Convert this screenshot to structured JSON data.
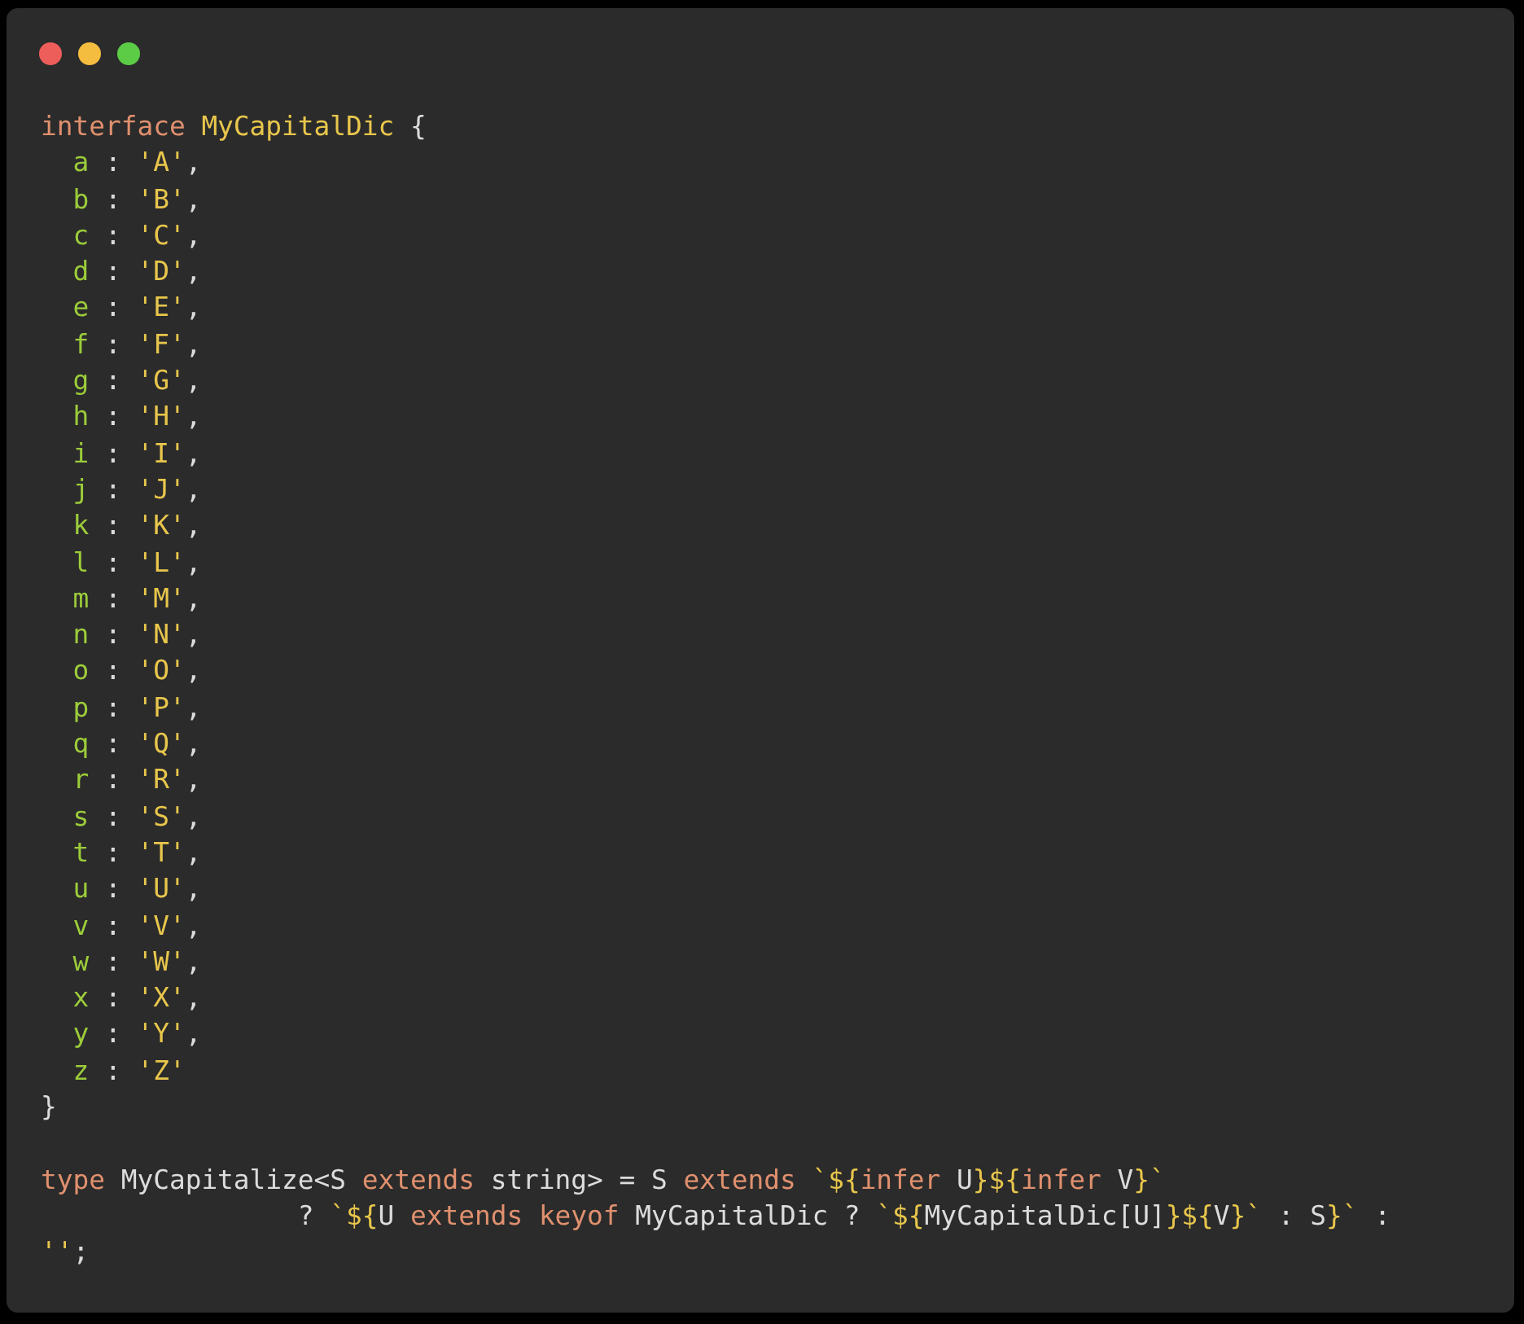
{
  "window": {
    "controls": [
      {
        "kind": "close"
      },
      {
        "kind": "minimize"
      },
      {
        "kind": "zoom"
      }
    ]
  },
  "code": {
    "lines": [
      {
        "kind": "code",
        "tokens": [
          {
            "kind": "kw",
            "text": "interface "
          },
          {
            "kind": "type",
            "text": "MyCapitalDic"
          },
          {
            "kind": "plain",
            "text": " {"
          }
        ]
      },
      {
        "kind": "code",
        "tokens": [
          {
            "kind": "prop",
            "text": "  a"
          },
          {
            "kind": "plain",
            "text": " : "
          },
          {
            "kind": "str",
            "text": "'A'"
          },
          {
            "kind": "plain",
            "text": ","
          }
        ]
      },
      {
        "kind": "code",
        "tokens": [
          {
            "kind": "prop",
            "text": "  b"
          },
          {
            "kind": "plain",
            "text": " : "
          },
          {
            "kind": "str",
            "text": "'B'"
          },
          {
            "kind": "plain",
            "text": ","
          }
        ]
      },
      {
        "kind": "code",
        "tokens": [
          {
            "kind": "prop",
            "text": "  c"
          },
          {
            "kind": "plain",
            "text": " : "
          },
          {
            "kind": "str",
            "text": "'C'"
          },
          {
            "kind": "plain",
            "text": ","
          }
        ]
      },
      {
        "kind": "code",
        "tokens": [
          {
            "kind": "prop",
            "text": "  d"
          },
          {
            "kind": "plain",
            "text": " : "
          },
          {
            "kind": "str",
            "text": "'D'"
          },
          {
            "kind": "plain",
            "text": ","
          }
        ]
      },
      {
        "kind": "code",
        "tokens": [
          {
            "kind": "prop",
            "text": "  e"
          },
          {
            "kind": "plain",
            "text": " : "
          },
          {
            "kind": "str",
            "text": "'E'"
          },
          {
            "kind": "plain",
            "text": ","
          }
        ]
      },
      {
        "kind": "code",
        "tokens": [
          {
            "kind": "prop",
            "text": "  f"
          },
          {
            "kind": "plain",
            "text": " : "
          },
          {
            "kind": "str",
            "text": "'F'"
          },
          {
            "kind": "plain",
            "text": ","
          }
        ]
      },
      {
        "kind": "code",
        "tokens": [
          {
            "kind": "prop",
            "text": "  g"
          },
          {
            "kind": "plain",
            "text": " : "
          },
          {
            "kind": "str",
            "text": "'G'"
          },
          {
            "kind": "plain",
            "text": ","
          }
        ]
      },
      {
        "kind": "code",
        "tokens": [
          {
            "kind": "prop",
            "text": "  h"
          },
          {
            "kind": "plain",
            "text": " : "
          },
          {
            "kind": "str",
            "text": "'H'"
          },
          {
            "kind": "plain",
            "text": ","
          }
        ]
      },
      {
        "kind": "code",
        "tokens": [
          {
            "kind": "prop",
            "text": "  i"
          },
          {
            "kind": "plain",
            "text": " : "
          },
          {
            "kind": "str",
            "text": "'I'"
          },
          {
            "kind": "plain",
            "text": ","
          }
        ]
      },
      {
        "kind": "code",
        "tokens": [
          {
            "kind": "prop",
            "text": "  j"
          },
          {
            "kind": "plain",
            "text": " : "
          },
          {
            "kind": "str",
            "text": "'J'"
          },
          {
            "kind": "plain",
            "text": ","
          }
        ]
      },
      {
        "kind": "code",
        "tokens": [
          {
            "kind": "prop",
            "text": "  k"
          },
          {
            "kind": "plain",
            "text": " : "
          },
          {
            "kind": "str",
            "text": "'K'"
          },
          {
            "kind": "plain",
            "text": ","
          }
        ]
      },
      {
        "kind": "code",
        "tokens": [
          {
            "kind": "prop",
            "text": "  l"
          },
          {
            "kind": "plain",
            "text": " : "
          },
          {
            "kind": "str",
            "text": "'L'"
          },
          {
            "kind": "plain",
            "text": ","
          }
        ]
      },
      {
        "kind": "code",
        "tokens": [
          {
            "kind": "prop",
            "text": "  m"
          },
          {
            "kind": "plain",
            "text": " : "
          },
          {
            "kind": "str",
            "text": "'M'"
          },
          {
            "kind": "plain",
            "text": ","
          }
        ]
      },
      {
        "kind": "code",
        "tokens": [
          {
            "kind": "prop",
            "text": "  n"
          },
          {
            "kind": "plain",
            "text": " : "
          },
          {
            "kind": "str",
            "text": "'N'"
          },
          {
            "kind": "plain",
            "text": ","
          }
        ]
      },
      {
        "kind": "code",
        "tokens": [
          {
            "kind": "prop",
            "text": "  o"
          },
          {
            "kind": "plain",
            "text": " : "
          },
          {
            "kind": "str",
            "text": "'O'"
          },
          {
            "kind": "plain",
            "text": ","
          }
        ]
      },
      {
        "kind": "code",
        "tokens": [
          {
            "kind": "prop",
            "text": "  p"
          },
          {
            "kind": "plain",
            "text": " : "
          },
          {
            "kind": "str",
            "text": "'P'"
          },
          {
            "kind": "plain",
            "text": ","
          }
        ]
      },
      {
        "kind": "code",
        "tokens": [
          {
            "kind": "prop",
            "text": "  q"
          },
          {
            "kind": "plain",
            "text": " : "
          },
          {
            "kind": "str",
            "text": "'Q'"
          },
          {
            "kind": "plain",
            "text": ","
          }
        ]
      },
      {
        "kind": "code",
        "tokens": [
          {
            "kind": "prop",
            "text": "  r"
          },
          {
            "kind": "plain",
            "text": " : "
          },
          {
            "kind": "str",
            "text": "'R'"
          },
          {
            "kind": "plain",
            "text": ","
          }
        ]
      },
      {
        "kind": "code",
        "tokens": [
          {
            "kind": "prop",
            "text": "  s"
          },
          {
            "kind": "plain",
            "text": " : "
          },
          {
            "kind": "str",
            "text": "'S'"
          },
          {
            "kind": "plain",
            "text": ","
          }
        ]
      },
      {
        "kind": "code",
        "tokens": [
          {
            "kind": "prop",
            "text": "  t"
          },
          {
            "kind": "plain",
            "text": " : "
          },
          {
            "kind": "str",
            "text": "'T'"
          },
          {
            "kind": "plain",
            "text": ","
          }
        ]
      },
      {
        "kind": "code",
        "tokens": [
          {
            "kind": "prop",
            "text": "  u"
          },
          {
            "kind": "plain",
            "text": " : "
          },
          {
            "kind": "str",
            "text": "'U'"
          },
          {
            "kind": "plain",
            "text": ","
          }
        ]
      },
      {
        "kind": "code",
        "tokens": [
          {
            "kind": "prop",
            "text": "  v"
          },
          {
            "kind": "plain",
            "text": " : "
          },
          {
            "kind": "str",
            "text": "'V'"
          },
          {
            "kind": "plain",
            "text": ","
          }
        ]
      },
      {
        "kind": "code",
        "tokens": [
          {
            "kind": "prop",
            "text": "  w"
          },
          {
            "kind": "plain",
            "text": " : "
          },
          {
            "kind": "str",
            "text": "'W'"
          },
          {
            "kind": "plain",
            "text": ","
          }
        ]
      },
      {
        "kind": "code",
        "tokens": [
          {
            "kind": "prop",
            "text": "  x"
          },
          {
            "kind": "plain",
            "text": " : "
          },
          {
            "kind": "str",
            "text": "'X'"
          },
          {
            "kind": "plain",
            "text": ","
          }
        ]
      },
      {
        "kind": "code",
        "tokens": [
          {
            "kind": "prop",
            "text": "  y"
          },
          {
            "kind": "plain",
            "text": " : "
          },
          {
            "kind": "str",
            "text": "'Y'"
          },
          {
            "kind": "plain",
            "text": ","
          }
        ]
      },
      {
        "kind": "code",
        "tokens": [
          {
            "kind": "prop",
            "text": "  z"
          },
          {
            "kind": "plain",
            "text": " : "
          },
          {
            "kind": "str",
            "text": "'Z'"
          }
        ]
      },
      {
        "kind": "code",
        "tokens": [
          {
            "kind": "plain",
            "text": "}"
          }
        ]
      },
      {
        "kind": "blank"
      },
      {
        "kind": "code",
        "tokens": [
          {
            "kind": "kw",
            "text": "type"
          },
          {
            "kind": "plain",
            "text": " MyCapitalize<S "
          },
          {
            "kind": "kw",
            "text": "extends"
          },
          {
            "kind": "plain",
            "text": " string> = S "
          },
          {
            "kind": "kw",
            "text": "extends "
          },
          {
            "kind": "str",
            "text": "`${"
          },
          {
            "kind": "kw",
            "text": "infer"
          },
          {
            "kind": "plain",
            "text": " U"
          },
          {
            "kind": "str",
            "text": "}${"
          },
          {
            "kind": "kw",
            "text": "infer"
          },
          {
            "kind": "plain",
            "text": " V"
          },
          {
            "kind": "str",
            "text": "}`"
          }
        ]
      },
      {
        "kind": "code",
        "tokens": [
          {
            "kind": "plain",
            "text": "                ? "
          },
          {
            "kind": "str",
            "text": "`${"
          },
          {
            "kind": "plain",
            "text": "U "
          },
          {
            "kind": "kw",
            "text": "extends "
          },
          {
            "kind": "kw",
            "text": "keyof"
          },
          {
            "kind": "plain",
            "text": " MyCapitalDic ? "
          },
          {
            "kind": "str",
            "text": "`${"
          },
          {
            "kind": "plain",
            "text": "MyCapitalDic[U]"
          },
          {
            "kind": "str",
            "text": "}${"
          },
          {
            "kind": "plain",
            "text": "V"
          },
          {
            "kind": "str",
            "text": "}`"
          },
          {
            "kind": "plain",
            "text": " : S"
          },
          {
            "kind": "str",
            "text": "}`"
          },
          {
            "kind": "plain",
            "text": " :"
          }
        ]
      },
      {
        "kind": "code",
        "tokens": [
          {
            "kind": "str",
            "text": "''"
          },
          {
            "kind": "plain",
            "text": ";"
          }
        ]
      }
    ]
  }
}
